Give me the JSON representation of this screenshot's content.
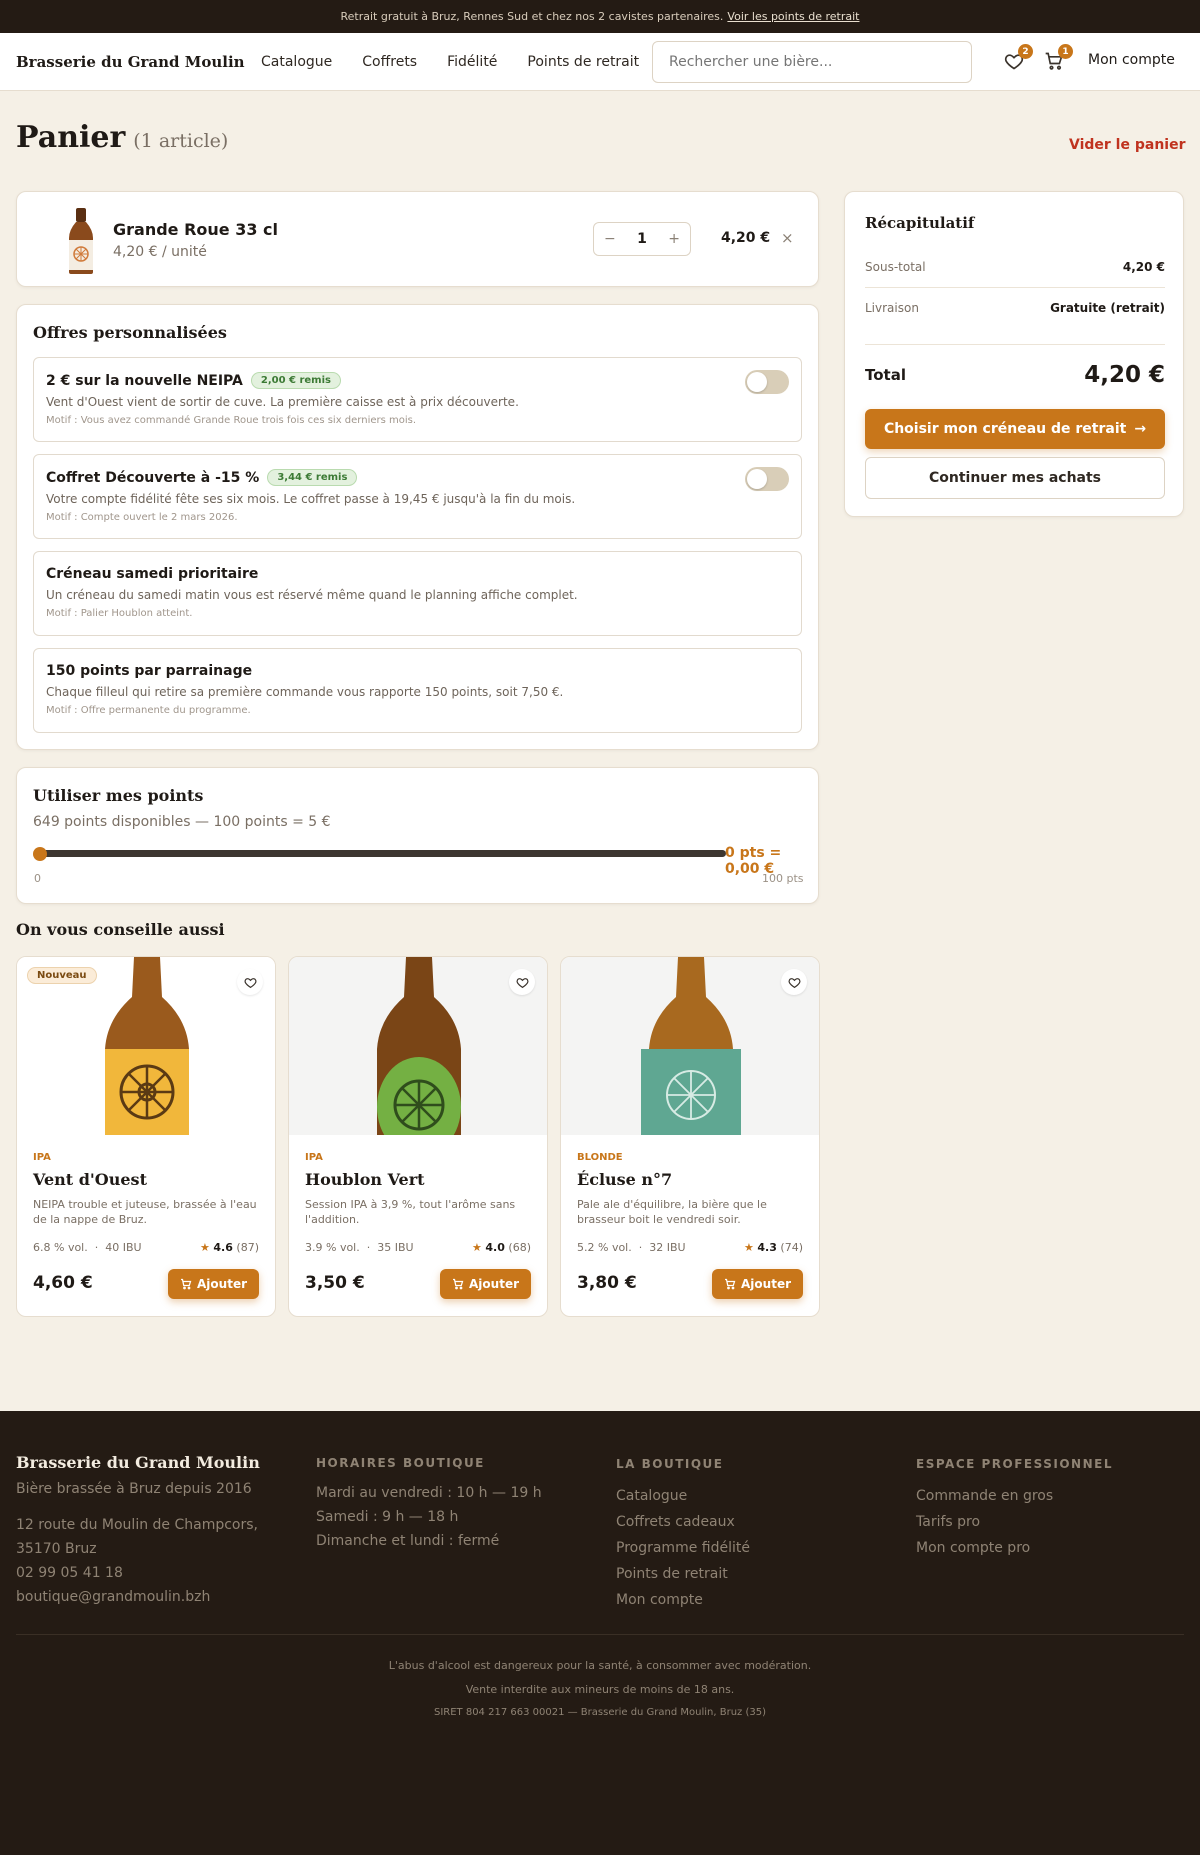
{
  "topbar": {
    "text": "Retrait gratuit à Bruz, Rennes Sud et chez nos 2 cavistes partenaires.",
    "link": "Voir les points de retrait"
  },
  "header": {
    "brand": "Brasserie du Grand Moulin",
    "nav": [
      "Catalogue",
      "Coffrets",
      "Fidélité",
      "Points de retrait"
    ],
    "search_placeholder": "Rechercher une bière...",
    "wishlist_count": "2",
    "cart_count": "1",
    "account": "Mon compte"
  },
  "page": {
    "title": "Panier",
    "count": "(1 article)",
    "clear": "Vider le panier"
  },
  "cart_item": {
    "name": "Grande Roue 33 cl",
    "unit": "4,20 € / unité",
    "qty": "1",
    "minus": "−",
    "plus": "+",
    "price": "4,20 €",
    "remove": "×"
  },
  "offers": {
    "title": "Offres personnalisées",
    "items": [
      {
        "title": "2 € sur la nouvelle NEIPA",
        "pill": "2,00 € remis",
        "desc": "Vent d'Ouest vient de sortir de cuve. La première caisse est à prix découverte.",
        "motif": "Motif : Vous avez commandé Grande Roue trois fois ces six derniers mois.",
        "toggle": "off"
      },
      {
        "title": "Coffret Découverte à -15 %",
        "pill": "3,44 € remis",
        "desc": "Votre compte fidélité fête ses six mois. Le coffret passe à 19,45 € jusqu'à la fin du mois.",
        "motif": "Motif : Compte ouvert le 2 mars 2026.",
        "toggle": "off"
      },
      {
        "title": "Créneau samedi prioritaire",
        "desc": "Un créneau du samedi matin vous est réservé même quand le planning affiche complet.",
        "motif": "Motif : Palier Houblon atteint."
      },
      {
        "title": "150 points par parrainage",
        "desc": "Chaque filleul qui retire sa première commande vous rapporte 150 points, soit 7,50 €.",
        "motif": "Motif : Offre permanente du programme."
      }
    ]
  },
  "points": {
    "title": "Utiliser mes points",
    "sub": "649 points disponibles — 100 points = 5 €",
    "value": "0 pts = 0,00 €",
    "min": "0",
    "max": "100 pts",
    "slider_value": 0
  },
  "reco": {
    "title": "On vous conseille aussi",
    "products": [
      {
        "badge": "Nouveau",
        "style": "IPA",
        "name": "Vent d'Ouest",
        "desc": "NEIPA trouble et juteuse, brassée à l'eau de la nappe de Bruz.",
        "abv": "6.8 % vol.",
        "ibu": "40 IBU",
        "rating": "4.6",
        "reviews": "(87)",
        "price": "4,60 €",
        "add": "Ajouter",
        "label_color": "#f1b73b"
      },
      {
        "style": "IPA",
        "name": "Houblon Vert",
        "desc": "Session IPA à 3,9 %, tout l'arôme sans l'addition.",
        "abv": "3.9 % vol.",
        "ibu": "35 IBU",
        "rating": "4.0",
        "reviews": "(68)",
        "price": "3,50 €",
        "add": "Ajouter",
        "label_color": "#74b043"
      },
      {
        "style": "BLONDE",
        "name": "Écluse n°7",
        "desc": "Pale ale d'équilibre, la bière que le brasseur boit le vendredi soir.",
        "abv": "5.2 % vol.",
        "ibu": "32 IBU",
        "rating": "4.3",
        "reviews": "(74)",
        "price": "3,80 €",
        "add": "Ajouter",
        "label_color": "#5fa792"
      }
    ]
  },
  "summary": {
    "title": "Récapitulatif",
    "subtotal_label": "Sous-total",
    "subtotal": "4,20 €",
    "delivery_label": "Livraison",
    "delivery": "Gratuite (retrait)",
    "total_label": "Total",
    "total": "4,20 €",
    "cta": "Choisir mon créneau de retrait",
    "continue": "Continuer mes achats"
  },
  "footer": {
    "brand": "Brasserie du Grand Moulin",
    "tagline": "Bière brassée à Bruz depuis 2016",
    "address1": "12 route du Moulin de Champcors,",
    "address2": "35170 Bruz",
    "phone": "02 99 05 41 18",
    "email": "boutique@grandmoulin.bzh",
    "hours_title": "HORAIRES BOUTIQUE",
    "hours": [
      "Mardi au vendredi : 10 h — 19 h",
      "Samedi : 9 h — 18 h",
      "Dimanche et lundi : fermé"
    ],
    "shop_title": "LA BOUTIQUE",
    "shop": [
      "Catalogue",
      "Coffrets cadeaux",
      "Programme fidélité",
      "Points de retrait",
      "Mon compte"
    ],
    "pro_title": "ESPACE PROFESSIONNEL",
    "pro": [
      "Commande en gros",
      "Tarifs pro",
      "Mon compte pro"
    ],
    "legal1": "L'abus d'alcool est dangereux pour la santé, à consommer avec modération.",
    "legal2": "Vente interdite aux mineurs de moins de 18 ans.",
    "legal3": "SIRET 804 217 663 00021 — Brasserie du Grand Moulin, Bruz (35)"
  },
  "colors": {
    "accent": "#c8761a",
    "dark": "#241b14",
    "background": "#f5f0e6",
    "danger": "#c0331f"
  }
}
